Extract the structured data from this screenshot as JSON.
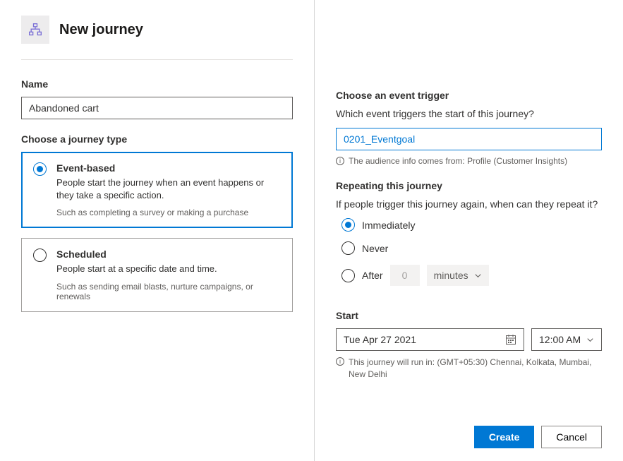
{
  "header": {
    "title": "New journey"
  },
  "name": {
    "label": "Name",
    "value": "Abandoned cart"
  },
  "journey_type": {
    "label": "Choose a journey type",
    "event": {
      "title": "Event-based",
      "desc": "People start the journey when an event happens or they take a specific action.",
      "hint": "Such as completing a survey or making a purchase"
    },
    "scheduled": {
      "title": "Scheduled",
      "desc": "People start at a specific date and time.",
      "hint": "Such as sending email blasts, nurture campaigns, or renewals"
    }
  },
  "trigger": {
    "label": "Choose an event trigger",
    "sub": "Which event triggers the start of this journey?",
    "value": "0201_Eventgoal",
    "info": "The audience info comes from: Profile (Customer Insights)"
  },
  "repeat": {
    "label": "Repeating this journey",
    "sub": "If people trigger this journey again, when can they repeat it?",
    "immediately": "Immediately",
    "never": "Never",
    "after": "After",
    "after_value": "0",
    "after_unit": "minutes"
  },
  "start": {
    "label": "Start",
    "date": "Tue Apr 27 2021",
    "time": "12:00 AM",
    "tz": "This journey will run in: (GMT+05:30) Chennai, Kolkata, Mumbai, New Delhi"
  },
  "actions": {
    "create": "Create",
    "cancel": "Cancel"
  }
}
